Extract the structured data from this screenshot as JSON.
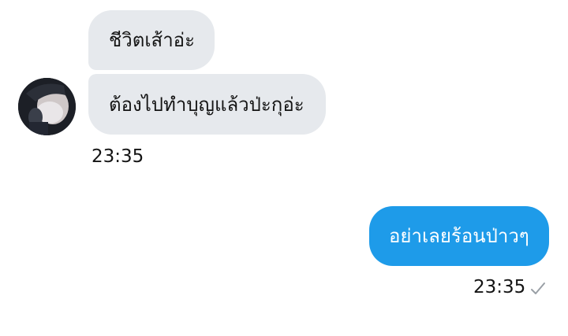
{
  "chat": {
    "incoming": {
      "messages": [
        {
          "text": "ชีวิตเส้าอ่ะ"
        },
        {
          "text": "ต้องไปทำบุญแล้วป่ะกุอ่ะ"
        }
      ],
      "time": "23:35",
      "avatar_icon": "user-avatar-photo"
    },
    "outgoing": {
      "messages": [
        {
          "text": "อย่าเลยร้อนป่าวๆ"
        }
      ],
      "time": "23:35",
      "status_icon": "check-icon"
    }
  },
  "colors": {
    "incoming_bubble": "#e6e9ed",
    "outgoing_bubble": "#1e9be9",
    "outgoing_text": "#ffffff",
    "text": "#141414",
    "check": "#9aa0a6"
  }
}
